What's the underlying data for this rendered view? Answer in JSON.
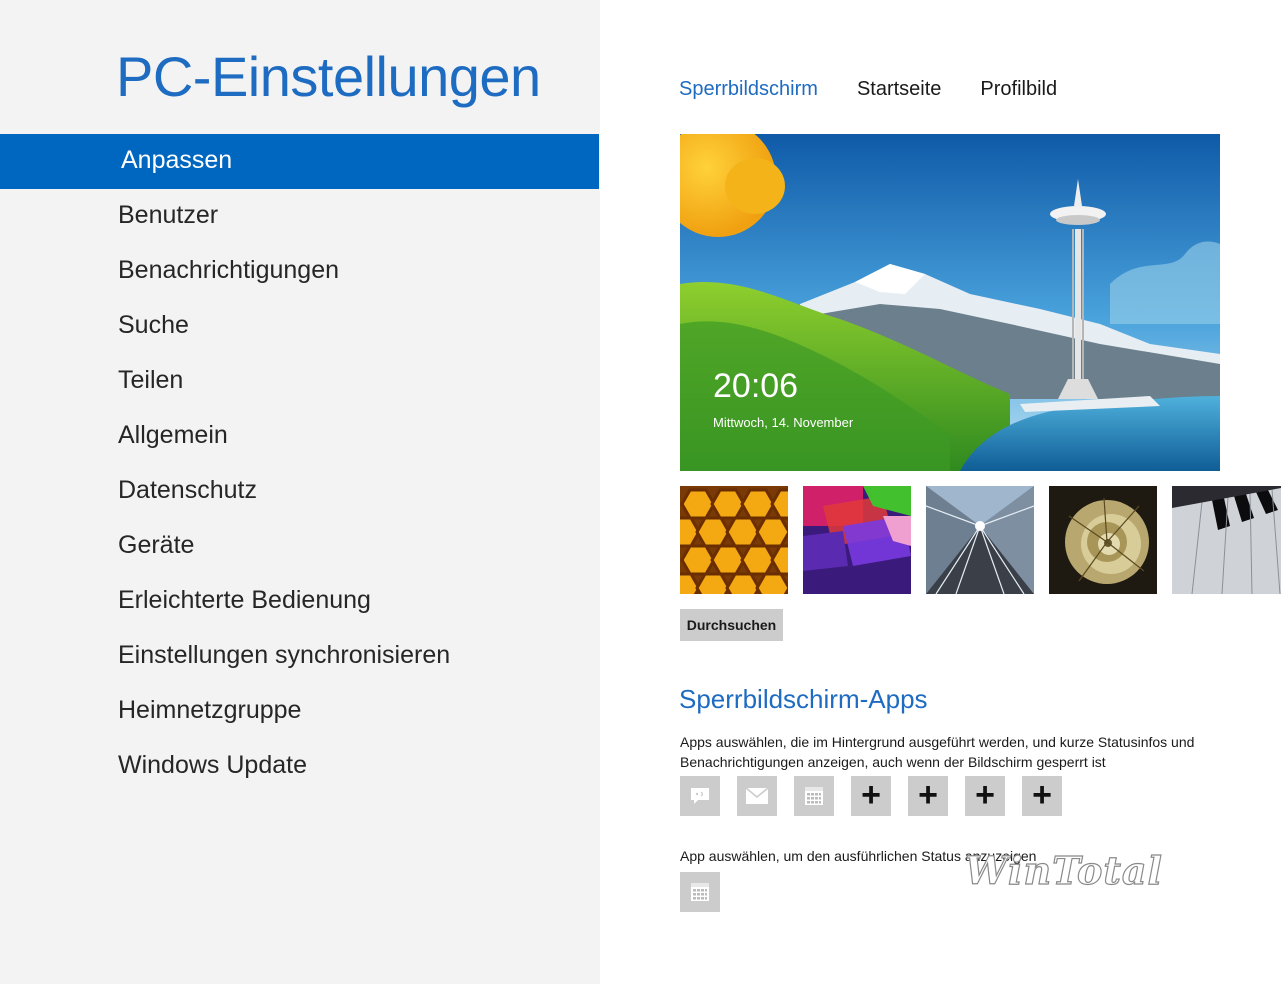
{
  "page_title": "PC-Einstellungen",
  "nav": {
    "items": [
      {
        "label": "Anpassen",
        "active": true
      },
      {
        "label": "Benutzer"
      },
      {
        "label": "Benachrichtigungen"
      },
      {
        "label": "Suche"
      },
      {
        "label": "Teilen"
      },
      {
        "label": "Allgemein"
      },
      {
        "label": "Datenschutz"
      },
      {
        "label": "Geräte"
      },
      {
        "label": "Erleichterte Bedienung"
      },
      {
        "label": "Einstellungen synchronisieren"
      },
      {
        "label": "Heimnetzgruppe"
      },
      {
        "label": "Windows Update"
      }
    ]
  },
  "tabs": [
    {
      "label": "Sperrbildschirm",
      "active": true
    },
    {
      "label": "Startseite"
    },
    {
      "label": "Profilbild"
    }
  ],
  "lock_screen_preview": {
    "time": "20:06",
    "date": "Mittwoch, 14. November"
  },
  "thumbnails": [
    "honeycomb-image",
    "geometric-shapes-image",
    "tunnel-image",
    "nautilus-shell-image",
    "piano-keys-image"
  ],
  "browse_button": "Durchsuchen",
  "lock_screen_apps": {
    "title": "Sperrbildschirm-Apps",
    "description": "Apps auswählen, die im Hintergrund ausgeführt werden, und kurze Statusinfos und Benachrichtigungen anzeigen, auch wenn der Bildschirm gesperrt ist",
    "slots": [
      {
        "icon": "messaging-icon"
      },
      {
        "icon": "mail-icon"
      },
      {
        "icon": "calendar-icon"
      },
      {
        "icon": "plus-icon",
        "label": "+"
      },
      {
        "icon": "plus-icon",
        "label": "+"
      },
      {
        "icon": "plus-icon",
        "label": "+"
      },
      {
        "icon": "plus-icon",
        "label": "+"
      }
    ],
    "detail_label": "App auswählen, um den ausführlichen Status anzuzeigen",
    "detail_slot_icon": "calendar-icon"
  },
  "watermark": "WinTotal",
  "colors": {
    "accent": "#1e6bc2",
    "nav_active_bg": "#0067c0",
    "left_pane_bg": "#f3f3f3",
    "slot_bg": "#cccccc"
  }
}
